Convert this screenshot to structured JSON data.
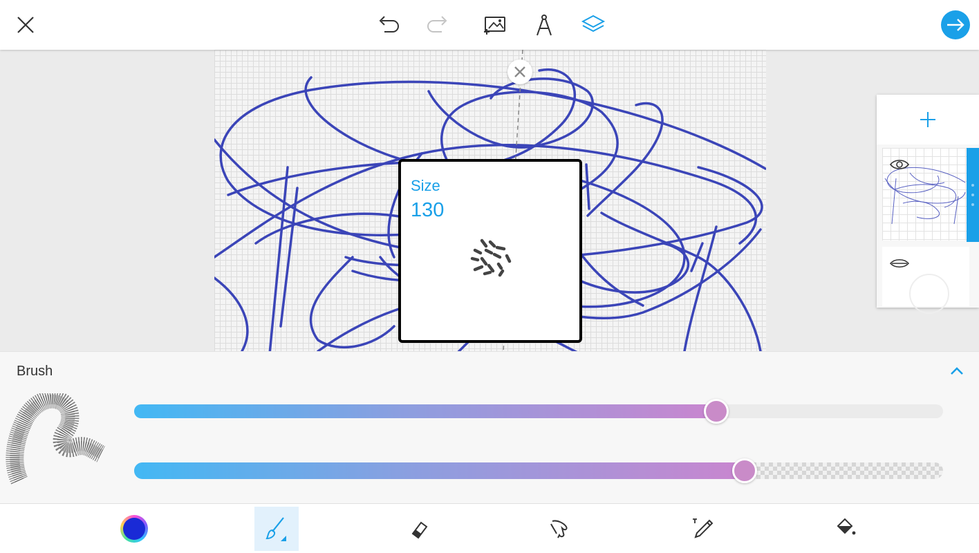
{
  "colors": {
    "accent": "#1aa0e8",
    "brush_color": "#1a2ad6",
    "stroke": "#3b45b8"
  },
  "topbar": {
    "close_icon": "close-icon",
    "undo_icon": "undo-icon",
    "redo_icon": "redo-icon",
    "add_image_icon": "add-image-icon",
    "drawing_guide_icon": "compass-icon",
    "layers_icon": "layers-icon",
    "next_icon": "arrow-right-icon"
  },
  "size_popup": {
    "label": "Size",
    "value": "130"
  },
  "brush_panel": {
    "title": "Brush",
    "size_slider_level": 0.72,
    "opacity_slider_level": 0.755
  },
  "bottombar": {
    "tools": [
      "color-picker",
      "brush",
      "eraser",
      "smudge",
      "text",
      "fill"
    ],
    "active_tool": "brush"
  }
}
